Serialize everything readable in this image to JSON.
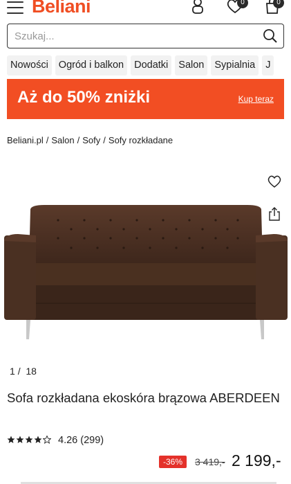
{
  "header": {
    "logo": "Beliani",
    "wishlist_count": "0",
    "cart_count": "0",
    "icons": [
      "menu-icon",
      "user-icon",
      "heart-icon",
      "bag-icon"
    ]
  },
  "search": {
    "placeholder": "Szukaj..."
  },
  "categories": [
    "Nowości",
    "Ogród i balkon",
    "Dodatki",
    "Salon",
    "Sypialnia",
    "J"
  ],
  "banner": {
    "text": "Aż do 50% zniżki",
    "link": "Kup teraz",
    "color": "#f24e23"
  },
  "breadcrumb": [
    "Beliani.pl",
    "Salon",
    "Sofy",
    "Sofy rozkładane"
  ],
  "gallery": {
    "current": "1",
    "separator": "/",
    "total": "18"
  },
  "product": {
    "title": "Sofa rozkładana ekoskóra brązowa ABERDEEN",
    "rating_value": 4.26,
    "rating": "4.26",
    "reviews": "(299)",
    "discount": "-36%",
    "old_price": "3 419,-",
    "price": "2 199,-"
  }
}
